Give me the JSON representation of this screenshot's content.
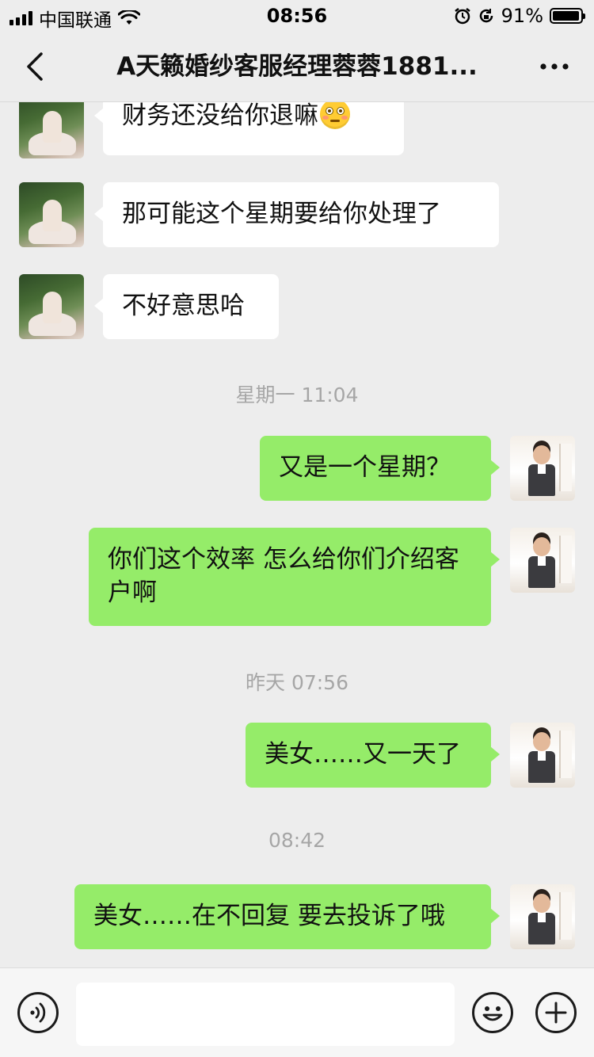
{
  "status_bar": {
    "carrier": "中国联通",
    "time": "08:56",
    "battery": "91%"
  },
  "header": {
    "title": "A天籁婚纱客服经理蓉蓉1881...",
    "back_icon": "chevron-left-icon",
    "more_icon": "more-dots-icon"
  },
  "messages": [
    {
      "side": "in",
      "text": "财务还没给你退嘛",
      "emoji": "flushed-face-icon"
    },
    {
      "side": "in",
      "text": "那可能这个星期要给你处理了"
    },
    {
      "side": "in",
      "text": "不好意思哈"
    },
    {
      "side": "out",
      "text": "又是一个星期？"
    },
    {
      "side": "out",
      "text": "你们这个效率 怎么给你们介绍客户啊"
    },
    {
      "side": "out",
      "text": "美女……又一天了"
    },
    {
      "side": "out",
      "text": "美女……在不回复 要去投诉了哦"
    }
  ],
  "timestamps": [
    "星期一 11:04",
    "昨天 07:56",
    "08:42"
  ],
  "input_bar": {
    "placeholder": "",
    "voice_icon": "voice-icon",
    "emoji_icon": "emoji-icon",
    "plus_icon": "plus-icon"
  },
  "colors": {
    "background": "#ededed",
    "outgoing_bubble": "#95ec69",
    "incoming_bubble": "#ffffff",
    "timestamp_text": "#a6a6a6"
  }
}
